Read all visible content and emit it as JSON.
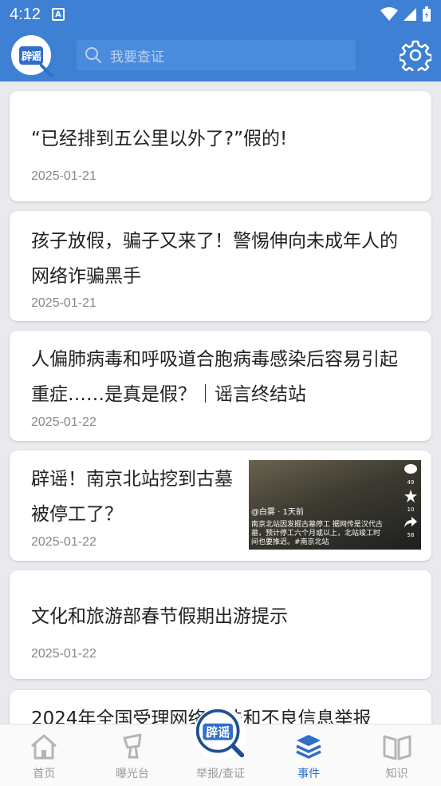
{
  "status_bar": {
    "time": "4:12",
    "notification_letter": "A"
  },
  "header": {
    "logo_text": "辟谣",
    "search": {
      "placeholder": "我要查证"
    }
  },
  "articles": [
    {
      "title": "“已经排到五公里以外了?”假的!",
      "date": "2025-01-21"
    },
    {
      "title": "孩子放假，骗子又来了！警惕伸向未成年人的网络诈骗黑手",
      "date": "2025-01-21"
    },
    {
      "title": "人偏肺病毒和呼吸道合胞病毒感染后容易引起重症……是真是假？｜谣言终结站",
      "date": "2025-01-22"
    },
    {
      "title": "辟谣！南京北站挖到古墓被停工了？",
      "date": "2025-01-22",
      "thumbnail": {
        "handle": "@白雾 · 1天前",
        "caption": "南京北站因发掘古墓停工 据网传是汉代古墓，预计停工六个月或以上，北站竣工时间也要推迟。#南京北站",
        "comments": "49",
        "stars": "10",
        "shares": "58"
      }
    },
    {
      "title": "文化和旅游部春节假期出游提示",
      "date": "2025-01-22"
    },
    {
      "title": "2024年全国受理网络违法和不良信息举报",
      "date": ""
    }
  ],
  "nav": {
    "home": "首页",
    "exposure": "曝光台",
    "report": "举报/查证",
    "events": "事件",
    "knowledge": "知识",
    "center_logo": "辟谣"
  },
  "colors": {
    "primary": "#3d80d4",
    "active": "#2f6ec9",
    "inactive": "#999999"
  }
}
